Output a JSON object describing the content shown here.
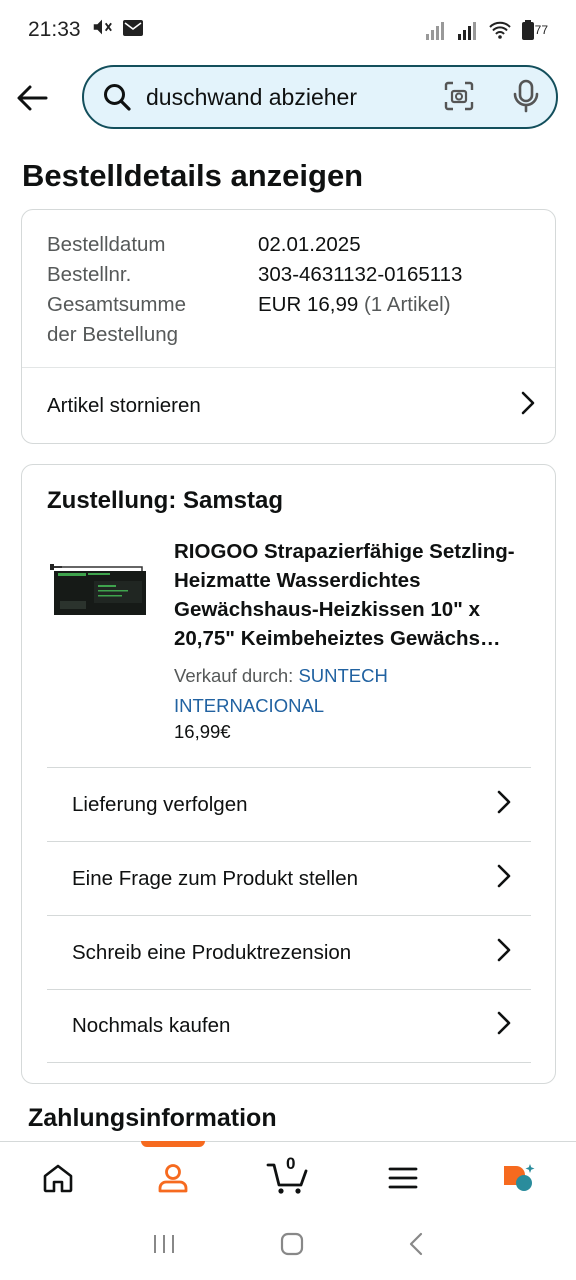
{
  "status": {
    "time": "21:33",
    "battery": "77"
  },
  "search": {
    "value": "duschwand abzieher"
  },
  "page_title": "Bestelldetails anzeigen",
  "order": {
    "date_label": "Bestelldatum",
    "date_value": "02.01.2025",
    "number_label": "Bestellnr.",
    "number_value": "303-4631132-0165113",
    "total_label_line1": "Gesamtsumme",
    "total_label_line2": "der Bestellung",
    "total_value": "EUR 16,99",
    "total_items": "(1 Artikel)",
    "cancel_label": "Artikel stornieren"
  },
  "delivery": {
    "title": "Zustellung: Samstag",
    "product_title": "RIOGOO Strapazierfähige Setzling-Heizmatte Wasserdichtes Gewächshaus-Heizkissen 10\" x 20,75\" Keimbeheiztes Gewächs…",
    "seller_prefix": "Verkauf durch:",
    "seller_name": "SUNTECH INTERNACIONAL",
    "price": "16,99€",
    "actions": [
      {
        "label": "Lieferung verfolgen"
      },
      {
        "label": "Eine Frage zum Produkt stellen"
      },
      {
        "label": "Schreib eine Produktrezension"
      },
      {
        "label": "Nochmals kaufen"
      }
    ]
  },
  "payment_title": "Zahlungsinformation",
  "bottom_nav": {
    "cart_count": "0",
    "active_tab": "account"
  },
  "colors": {
    "accent_orange": "#f66a1f",
    "search_border": "#134f5c",
    "search_bg": "#e3f3fb",
    "link_blue": "#2162a1"
  }
}
